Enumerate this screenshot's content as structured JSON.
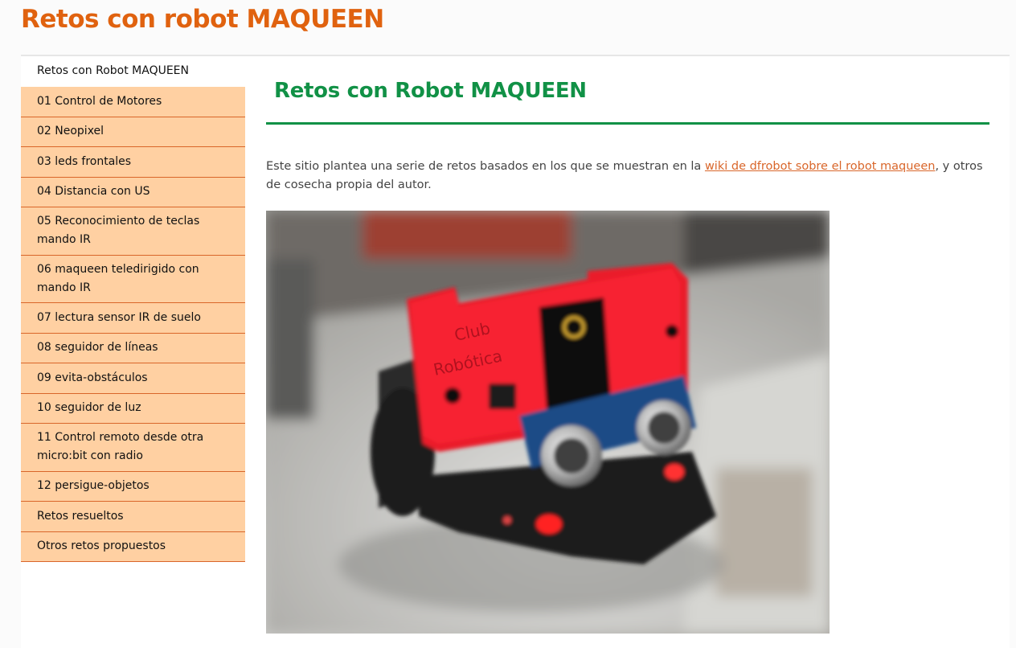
{
  "site": {
    "title": "Retos con robot MAQUEEN"
  },
  "sidebar": {
    "current": "Retos con Robot MAQUEEN",
    "items": [
      {
        "label": "01 Control de Motores"
      },
      {
        "label": "02 Neopixel"
      },
      {
        "label": "03 leds frontales"
      },
      {
        "label": "04 Distancia con US"
      },
      {
        "label": "05 Reconocimiento de teclas mando IR"
      },
      {
        "label": "06 maqueen teledirigido con mando IR"
      },
      {
        "label": "07 lectura sensor IR de suelo"
      },
      {
        "label": "08 seguidor de líneas"
      },
      {
        "label": "09 evita-obstáculos"
      },
      {
        "label": "10 seguidor de luz"
      },
      {
        "label": "11 Control remoto desde otra micro:bit con radio"
      },
      {
        "label": "12 persigue-objetos"
      },
      {
        "label": "Retos resueltos"
      },
      {
        "label": "Otros retos propuestos"
      }
    ]
  },
  "main": {
    "title": "Retos con Robot MAQUEEN",
    "intro_before": "Este sitio plantea una serie de retos basados en los que se muestran en la ",
    "intro_link": "wiki de dfrobot sobre el robot maqueen",
    "intro_after": ", y otros de cosecha propia del autor.",
    "photo_text_line1": "Club",
    "photo_text_line2": "Robótica"
  },
  "colors": {
    "accent_orange": "#e0620f",
    "accent_green": "#119146",
    "menu_bg": "#ffd0a2",
    "menu_border": "#d9662a"
  }
}
